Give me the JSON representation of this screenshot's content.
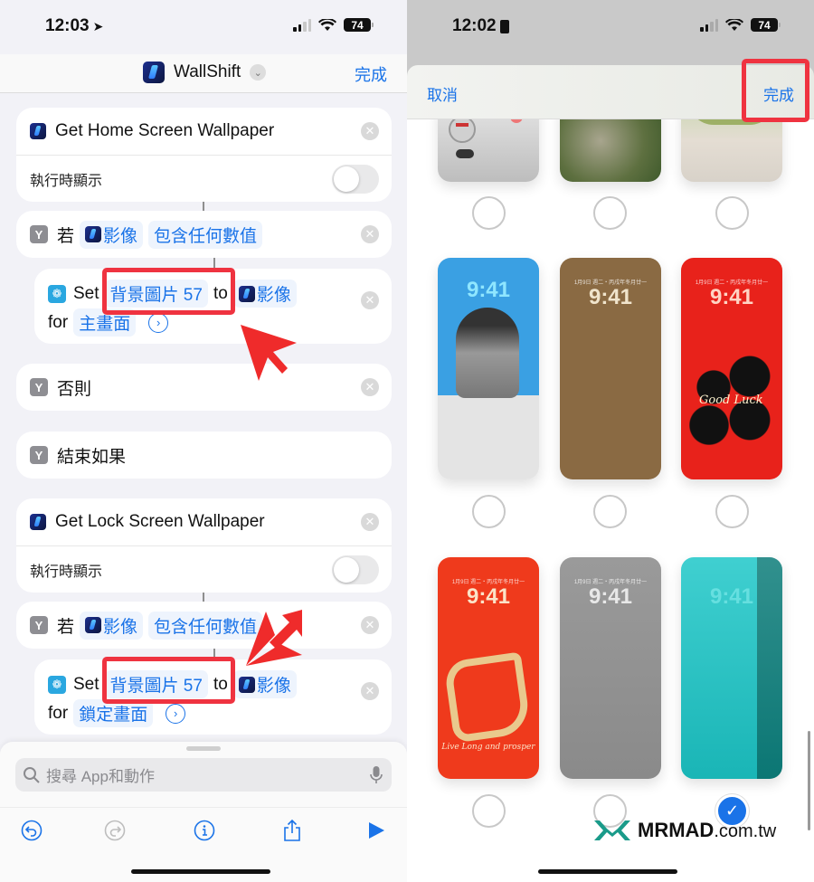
{
  "left": {
    "status": {
      "time": "12:03",
      "battery": "74"
    },
    "nav": {
      "title": "WallShift",
      "done": "完成"
    },
    "actions": {
      "get_home": {
        "title": "Get Home Screen Wallpaper",
        "show_when_run": "執行時顯示",
        "toggle_on": false
      },
      "if1": {
        "keyword": "若",
        "var": "影像",
        "condition": "包含任何數值"
      },
      "set1": {
        "verb": "Set",
        "wallpaper": "背景圖片 57",
        "to": "to",
        "var": "影像",
        "for": "for",
        "target": "主畫面"
      },
      "otherwise": {
        "label": "否則"
      },
      "end_if": {
        "label": "結束如果"
      },
      "get_lock": {
        "title": "Get Lock Screen Wallpaper",
        "show_when_run": "執行時顯示",
        "toggle_on": false
      },
      "if2": {
        "keyword": "若",
        "var": "影像",
        "condition": "包含任何數值"
      },
      "set2": {
        "verb": "Set",
        "wallpaper": "背景圖片 57",
        "to": "to",
        "var": "影像",
        "for": "for",
        "target": "鎖定畫面"
      }
    },
    "search": {
      "placeholder": "搜尋 App和動作"
    },
    "toolbar": [
      "undo-icon",
      "redo-icon",
      "info-icon",
      "share-icon",
      "play-icon"
    ],
    "annotation_color": "#ef3340",
    "accent": "#1a73e8"
  },
  "right": {
    "status": {
      "time": "12:02",
      "battery": "74"
    },
    "picker": {
      "cancel": "取消",
      "done": "完成"
    },
    "wallpapers": [
      {
        "name": "game-controller",
        "selected": false
      },
      {
        "name": "mossy-rocks",
        "selected": false
      },
      {
        "name": "green-grapes",
        "selected": false
      },
      {
        "name": "pixel-portrait",
        "time": "9:41",
        "selected": false
      },
      {
        "name": "brown-monogram",
        "date": "1月9日 週二・丙戌年冬月廿一",
        "time": "9:41",
        "selected": false
      },
      {
        "name": "red-good-luck",
        "date": "1月9日 週二・丙戌年冬月廿一",
        "time": "9:41",
        "caption": "Good Luck",
        "selected": false
      },
      {
        "name": "red-prosper",
        "date": "1月9日 週二・丙戌年冬月廿一",
        "time": "9:41",
        "caption": "Live Long and prosper",
        "selected": false
      },
      {
        "name": "gray-gradient",
        "date": "1月9日 週二・丙戌年冬月廿一",
        "time": "9:41",
        "selected": false
      },
      {
        "name": "turquoise-water",
        "time": "9:41",
        "selected": true
      }
    ],
    "watermark": {
      "brand": "MRMAD",
      "suffix": ".com.tw"
    }
  }
}
